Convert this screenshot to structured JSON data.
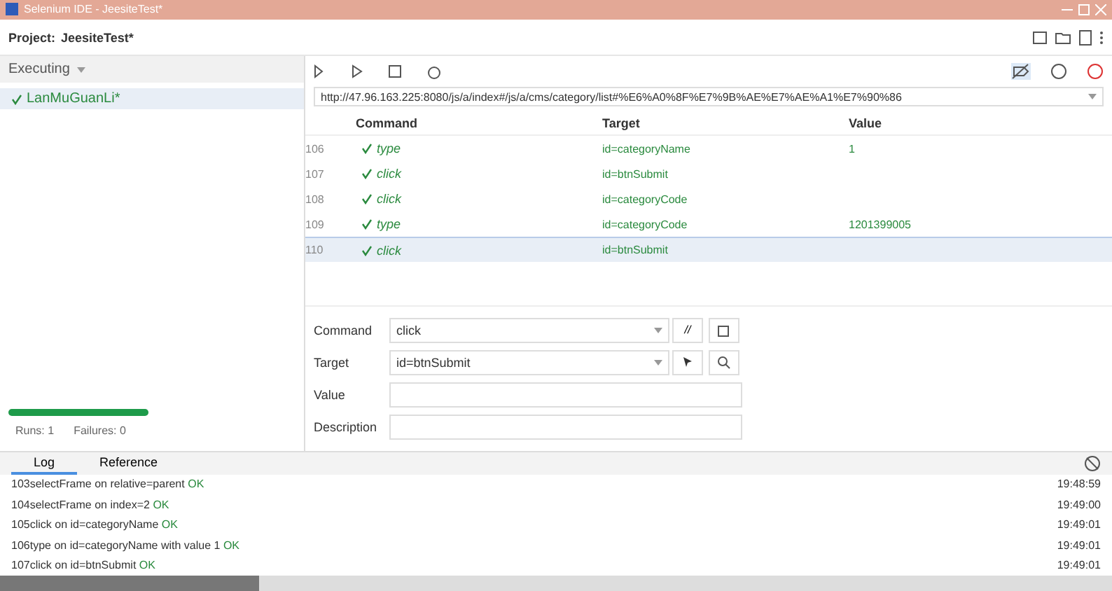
{
  "window": {
    "title": "Selenium IDE - JeesiteTest*"
  },
  "project": {
    "label": "Project:",
    "name": "JeesiteTest*"
  },
  "sidebar": {
    "header": "Executing",
    "tests": [
      {
        "name": "LanMuGuanLi*",
        "passed": true,
        "selected": true
      }
    ],
    "progress": {
      "level": 1
    },
    "runs": "Runs: 1",
    "failures": "Failures: 0"
  },
  "toolbar": {
    "url": "http://47.96.163.225:8080/js/a/index#/js/a/cms/category/list#%E6%A0%8F%E7%9B%AE%E7%AE%A1%E7%90%86",
    "breakpoints_disabled": true
  },
  "table": {
    "columns": [
      "Command",
      "Target",
      "Value"
    ],
    "rows": [
      {
        "number": "106",
        "command": "type",
        "target": "id=categoryName",
        "value": "1",
        "passed": true,
        "selected": false
      },
      {
        "number": "107",
        "command": "click",
        "target": "id=btnSubmit",
        "value": "",
        "passed": true,
        "selected": false
      },
      {
        "number": "108",
        "command": "click",
        "target": "id=categoryCode",
        "value": "",
        "passed": true,
        "selected": false
      },
      {
        "number": "109",
        "command": "type",
        "target": "id=categoryCode",
        "value": "1201399005",
        "passed": true,
        "selected": false
      },
      {
        "number": "110",
        "command": "click",
        "target": "id=btnSubmit",
        "value": "",
        "passed": true,
        "selected": true
      }
    ]
  },
  "editor": {
    "command_label": "Command",
    "command": "click",
    "comment_button": "//",
    "target_label": "Target",
    "target": "id=btnSubmit",
    "value_label": "Value",
    "description_label": "Description"
  },
  "log": {
    "tabs": [
      {
        "label": "Log",
        "selected": true
      },
      {
        "label": "Reference",
        "selected": false
      }
    ],
    "entries": [
      {
        "text": "103selectFrame on relative=parent",
        "status": "OK",
        "time": "19:48:59"
      },
      {
        "text": "104selectFrame on index=2",
        "status": "OK",
        "time": "19:49:00"
      },
      {
        "text": "105click on id=categoryName",
        "status": "OK",
        "time": "19:49:01"
      },
      {
        "text": "106type on id=categoryName with value 1",
        "status": "OK",
        "time": "19:49:01"
      },
      {
        "text": "107click on id=btnSubmit",
        "status": "OK",
        "time": "19:49:01"
      }
    ]
  }
}
